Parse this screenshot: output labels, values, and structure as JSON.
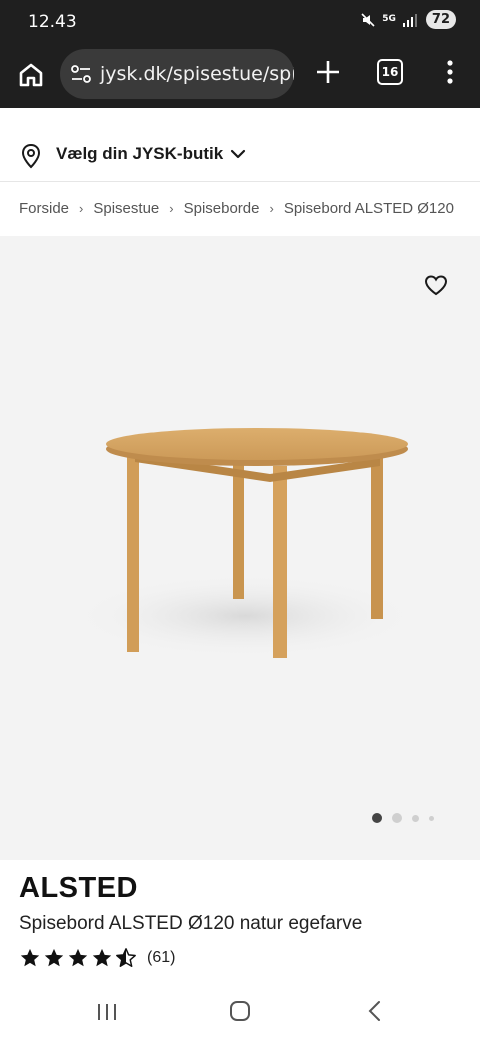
{
  "status_bar": {
    "time": "12.43",
    "network": "5G",
    "battery": "72"
  },
  "browser": {
    "url": "jysk.dk/spisestue/spisebord",
    "tab_count": "16"
  },
  "store_selector": {
    "label": "Vælg din JYSK-butik"
  },
  "breadcrumb": [
    "Forside",
    "Spisestue",
    "Spiseborde",
    "Spisebord ALSTED Ø120"
  ],
  "gallery": {
    "slide_count": 4,
    "active_slide": 1
  },
  "product": {
    "brand": "ALSTED",
    "name": "Spisebord ALSTED Ø120 natur egefarve",
    "rating_stars": 4.5,
    "rating_count": "(61)"
  },
  "icons": {
    "home": "home-icon",
    "site_info": "site-settings-icon",
    "new_tab": "plus-icon",
    "tabs": "tab-switcher-icon",
    "menu": "more-vert-icon",
    "store": "location-pin-icon",
    "wishlist": "heart-icon"
  },
  "colors": {
    "browser_bg": "#1f1f1f",
    "url_bg": "#3a3a3a",
    "image_bg": "#f3f3f3",
    "wood": "#d4a563"
  }
}
